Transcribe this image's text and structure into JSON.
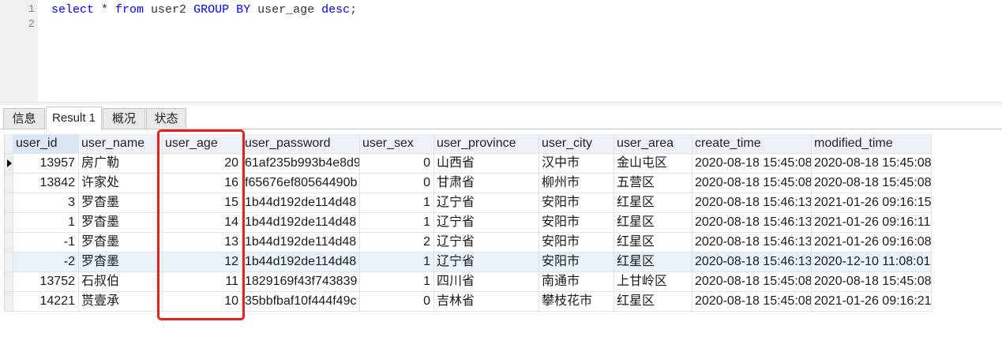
{
  "colors": {
    "keyword": "#0000ff",
    "code_text": "#333333",
    "highlight_box": "#e5231d"
  },
  "editor": {
    "lines": [
      {
        "number": "1",
        "tokens": [
          {
            "text": "select",
            "kind": "keyword"
          },
          {
            "text": " * ",
            "kind": "text"
          },
          {
            "text": "from",
            "kind": "keyword"
          },
          {
            "text": " user2 ",
            "kind": "text"
          },
          {
            "text": "GROUP BY",
            "kind": "keyword"
          },
          {
            "text": " user_age ",
            "kind": "text"
          },
          {
            "text": "desc",
            "kind": "keyword"
          },
          {
            "text": ";",
            "kind": "text"
          }
        ]
      },
      {
        "number": "2",
        "tokens": []
      }
    ]
  },
  "tabs": [
    {
      "label": "信息",
      "active": false
    },
    {
      "label": "Result 1",
      "active": true
    },
    {
      "label": "概况",
      "active": false
    },
    {
      "label": "状态",
      "active": false
    }
  ],
  "grid": {
    "columns": [
      "user_id",
      "user_name",
      "user_age",
      "user_password",
      "user_sex",
      "user_province",
      "user_city",
      "user_area",
      "create_time",
      "modified_time"
    ],
    "current_row": 0,
    "highlighted_row": 5,
    "rows": [
      [
        "13957",
        "房广勒",
        "20",
        "61af235b993b4e8d9",
        "0",
        "山西省",
        "汉中市",
        "金山屯区",
        "2020-08-18 15:45:08",
        "2020-08-18 15:45:08"
      ],
      [
        "13842",
        "许家处",
        "16",
        "f65676ef80564490b",
        "0",
        "甘肃省",
        "柳州市",
        "五营区",
        "2020-08-18 15:45:08",
        "2020-08-18 15:45:08"
      ],
      [
        "3",
        "罗杳墨",
        "15",
        "1b44d192de114d48",
        "1",
        "辽宁省",
        "安阳市",
        "红星区",
        "2020-08-18 15:46:13",
        "2021-01-26 09:16:15"
      ],
      [
        "1",
        "罗杳墨",
        "14",
        "1b44d192de114d48",
        "1",
        "辽宁省",
        "安阳市",
        "红星区",
        "2020-08-18 15:46:13",
        "2021-01-26 09:16:11"
      ],
      [
        "-1",
        "罗杳墨",
        "13",
        "1b44d192de114d48",
        "2",
        "辽宁省",
        "安阳市",
        "红星区",
        "2020-08-18 15:46:13",
        "2021-01-26 09:16:08"
      ],
      [
        "-2",
        "罗杳墨",
        "12",
        "1b44d192de114d48",
        "1",
        "辽宁省",
        "安阳市",
        "红星区",
        "2020-08-18 15:46:13",
        "2020-12-10 11:08:01"
      ],
      [
        "13752",
        "石叔伯",
        "11",
        "1829169f43f743839",
        "1",
        "四川省",
        "南通市",
        "上甘岭区",
        "2020-08-18 15:45:08",
        "2020-08-18 15:45:08"
      ],
      [
        "14221",
        "贳壹承",
        "10",
        "35bbfbaf10f444f49c",
        "0",
        "吉林省",
        "攀枝花市",
        "红星区",
        "2020-08-18 15:45:08",
        "2021-01-26 09:16:21"
      ]
    ]
  }
}
